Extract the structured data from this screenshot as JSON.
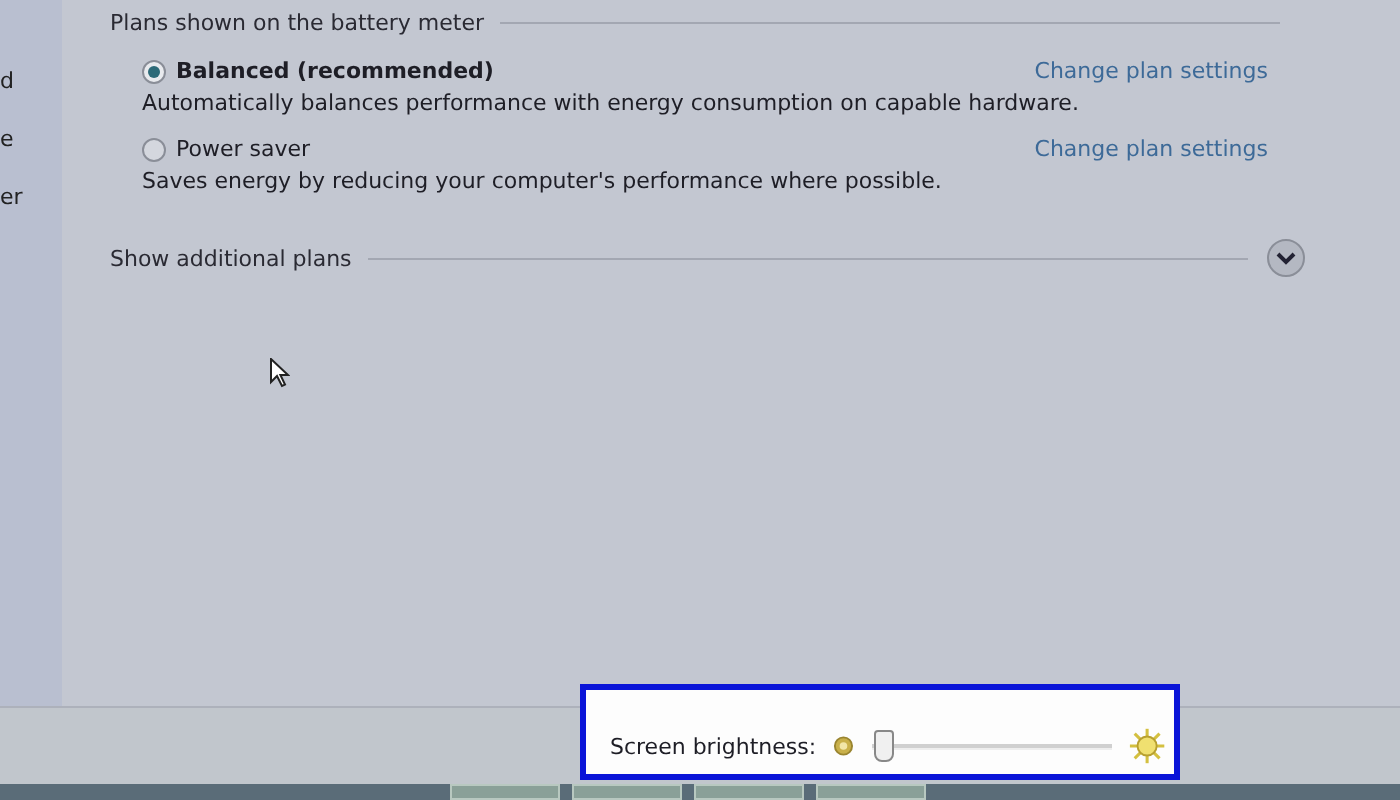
{
  "sidebar": {
    "items": [
      "d",
      "e",
      "er"
    ]
  },
  "section": {
    "title": "Plans shown on the battery meter"
  },
  "plans": [
    {
      "name": "Balanced (recommended)",
      "selected": true,
      "description": "Automatically balances performance with energy consumption on capable hardware.",
      "link": "Change plan settings"
    },
    {
      "name": "Power saver",
      "selected": false,
      "description": "Saves energy by reducing your computer's performance where possible.",
      "link": "Change plan settings"
    }
  ],
  "additional": {
    "label": "Show additional plans",
    "expanded": false
  },
  "brightness": {
    "label": "Screen brightness:",
    "level": 0.03
  }
}
